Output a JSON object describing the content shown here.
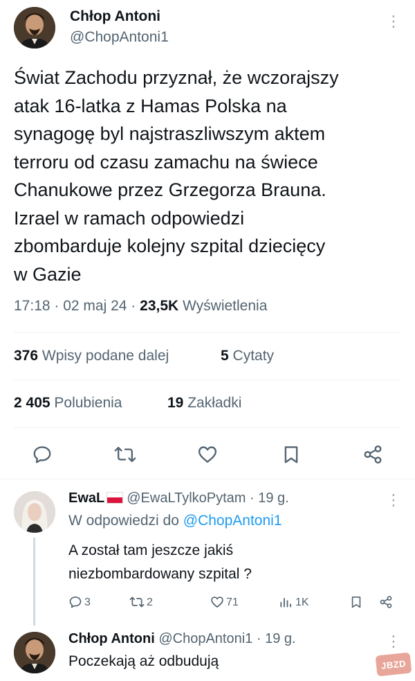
{
  "tweet": {
    "author_name": "Chłop Antoni",
    "author_handle": "@ChopAntoni1",
    "text_lines": [
      "Świat Zachodu przyznał, że wczorajszy",
      "atak 16-latka z Hamas Polska na",
      "synagogę byl najstraszliwszym aktem",
      "terroru od czasu zamachu na świece",
      "Chanukowe przez Grzegorza Brauna.",
      "Izrael w ramach odpowiedzi",
      "zbombarduje kolejny szpital dziecięcy",
      "w Gazie"
    ],
    "time": "17:18",
    "date": "02 maj 24",
    "views_count": "23,5K",
    "views_label": "Wyświetlenia",
    "reposts_count": "376",
    "reposts_label": "Wpisy podane dalej",
    "quotes_count": "5",
    "quotes_label": "Cytaty",
    "likes_count": "2 405",
    "likes_label": "Polubienia",
    "bookmarks_count": "19",
    "bookmarks_label": "Zakładki",
    "actions": [
      "reply-icon",
      "repost-icon",
      "like-icon",
      "bookmark-icon",
      "share-icon"
    ]
  },
  "reply1": {
    "author_name": "EwaL",
    "flag": "PL",
    "author_handle": "@EwaLTylkoPytam",
    "time": "19 g.",
    "replying_prefix": "W odpowiedzi do",
    "replying_to": "@ChopAntoni1",
    "text_lines": [
      "A został tam jeszcze jakiś",
      "niezbombardowany szpital ?"
    ],
    "replies": "3",
    "reposts": "2",
    "likes": "71",
    "views": "1K"
  },
  "reply2": {
    "author_name": "Chłop Antoni",
    "author_handle": "@ChopAntoni1",
    "time": "19 g.",
    "text": "Poczekają aż odbudują"
  },
  "watermark": "JBZD",
  "colors": {
    "text": "#0f1419",
    "secondary": "#536471",
    "link": "#1d9bf0",
    "divider": "#eff3f4",
    "watermark": "#e8a69a"
  }
}
